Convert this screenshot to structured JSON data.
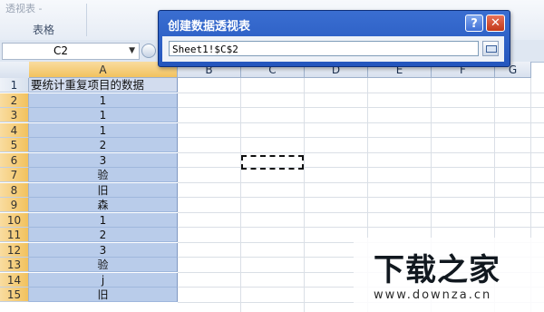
{
  "ribbon": {
    "tool_label": "透视表 -",
    "group_label": "表格"
  },
  "formula_bar": {
    "name_box": "C2"
  },
  "columns": [
    "A",
    "B",
    "C",
    "D",
    "E",
    "F",
    "G"
  ],
  "rows": [
    {
      "num": "1",
      "a": "要统计重复项目的数据"
    },
    {
      "num": "2",
      "a": "1"
    },
    {
      "num": "3",
      "a": "1"
    },
    {
      "num": "4",
      "a": "1"
    },
    {
      "num": "5",
      "a": "2"
    },
    {
      "num": "6",
      "a": "3"
    },
    {
      "num": "7",
      "a": "验"
    },
    {
      "num": "8",
      "a": "旧"
    },
    {
      "num": "9",
      "a": "森"
    },
    {
      "num": "10",
      "a": "1"
    },
    {
      "num": "11",
      "a": "2"
    },
    {
      "num": "12",
      "a": "3"
    },
    {
      "num": "13",
      "a": "验"
    },
    {
      "num": "14",
      "a": "j"
    },
    {
      "num": "15",
      "a": "旧"
    }
  ],
  "dialog": {
    "title": "创建数据透视表",
    "help_icon": "?",
    "close_icon": "✕",
    "range_value": "Sheet1!$C$2"
  },
  "watermark": {
    "title": "下载之家",
    "url": "www.downza.cn"
  }
}
